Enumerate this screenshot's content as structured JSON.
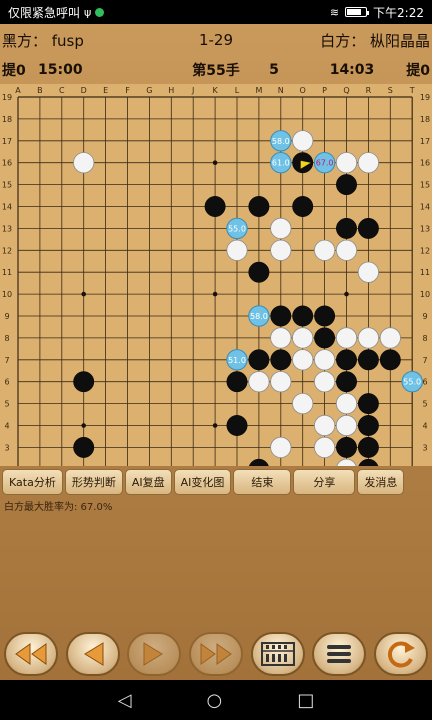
{
  "statusbar": {
    "left_text": "仅限紧急呼叫",
    "usb_icon": "usb-icon",
    "app_icon": "wechat-icon",
    "wifi_icon": "wifi-icon",
    "battery_label": "",
    "time": "下午2:22"
  },
  "header": {
    "black_player": "黑方：  fusp",
    "game_number": "1-29",
    "white_player": "白方：  枞阳晶晶"
  },
  "info": {
    "black_captures": "提0",
    "black_time": "15:00",
    "move_label": "第55手",
    "move_count": "5",
    "white_time": "14:03",
    "white_captures": "提0"
  },
  "board": {
    "columns": [
      "A",
      "B",
      "C",
      "D",
      "E",
      "F",
      "G",
      "H",
      "J",
      "K",
      "L",
      "M",
      "N",
      "O",
      "P",
      "Q",
      "R",
      "S",
      "T"
    ],
    "rows": [
      "19",
      "18",
      "17",
      "16",
      "15",
      "14",
      "13",
      "12",
      "11",
      "10",
      "9",
      "8",
      "7",
      "6",
      "5",
      "4",
      "3",
      "2",
      "1"
    ],
    "black_stones": [
      "O16",
      "Q15",
      "K14",
      "M14",
      "O14",
      "Q13",
      "R13",
      "M11",
      "N9",
      "O9",
      "P9",
      "P8",
      "M7",
      "N7",
      "Q7",
      "R7",
      "S7",
      "L6",
      "Q6",
      "D6",
      "R5",
      "L4",
      "R4",
      "D3",
      "Q3",
      "R3",
      "M2",
      "R2"
    ],
    "white_stones": [
      "D16",
      "O17",
      "Q16",
      "R16",
      "N13",
      "L12",
      "N12",
      "P12",
      "Q12",
      "R11",
      "N8",
      "O8",
      "Q8",
      "R8",
      "S8",
      "O7",
      "P7",
      "M6",
      "N6",
      "P6",
      "O5",
      "Q5",
      "P4",
      "Q4",
      "N3",
      "P3",
      "Q2"
    ],
    "candidates": [
      {
        "point": "N17",
        "value": "58.0"
      },
      {
        "point": "N16",
        "value": "61.0"
      },
      {
        "point": "P16",
        "value": "67.0"
      },
      {
        "point": "L13",
        "value": "55.0"
      },
      {
        "point": "M9",
        "value": "58.0"
      },
      {
        "point": "L7",
        "value": "51.0"
      },
      {
        "point": "T6",
        "value": "55.0"
      }
    ],
    "last_move": "O16"
  },
  "toolbar": {
    "buttons": [
      "Kata分析",
      "形势判断",
      "AI复盘",
      "AI变化图",
      "结束",
      "分享",
      "发消息"
    ]
  },
  "winrate_text": "白方最大胜率为: 67.0%",
  "bottom_controls": [
    {
      "icon": "fast-backward-icon"
    },
    {
      "icon": "step-back-icon"
    },
    {
      "icon": "step-forward-icon"
    },
    {
      "icon": "fast-forward-icon"
    },
    {
      "icon": "abacus-icon"
    },
    {
      "icon": "menu-icon"
    },
    {
      "icon": "refresh-icon"
    }
  ],
  "navbar": {
    "back_icon": "back-triangle-icon",
    "home_icon": "home-circle-icon",
    "recent_icon": "recent-square-icon"
  }
}
